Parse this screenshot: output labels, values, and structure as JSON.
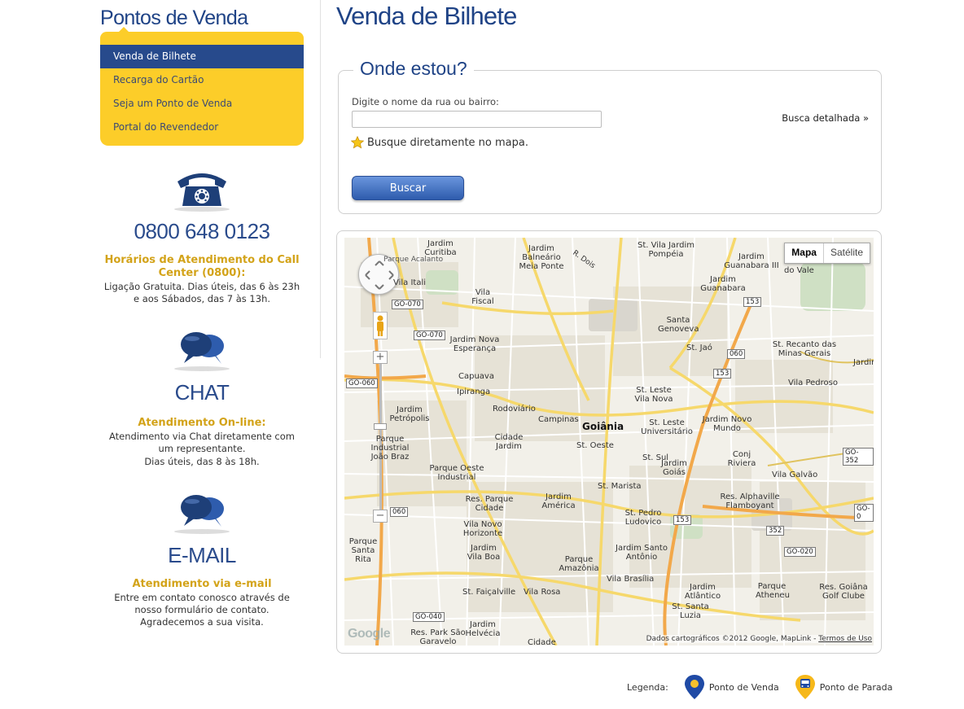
{
  "sidebar": {
    "title": "Pontos de Venda",
    "menu": [
      {
        "label": "Venda de Bilhete",
        "active": true
      },
      {
        "label": "Recarga do Cartão",
        "active": false
      },
      {
        "label": "Seja um Ponto de Venda",
        "active": false
      },
      {
        "label": "Portal do Revendedor",
        "active": false
      }
    ],
    "phone": {
      "icon": "telephone-icon",
      "number": "0800 648 0123",
      "heading": "Horários de Atendimento do Call Center (0800):",
      "text": "Ligação Gratuita. Dias úteis, das 6 às 23h e aos Sábados, das 7 às 13h."
    },
    "chat": {
      "icon": "chat-bubbles-icon",
      "title": "CHAT",
      "heading": "Atendimento On-line:",
      "text": "Atendimento via Chat diretamente com um representante.",
      "text2": "Dias úteis, das 8 às 18h."
    },
    "email": {
      "icon": "chat-bubbles-icon",
      "title": "E-MAIL",
      "heading": "Atendimento via e-mail",
      "text": "Entre em contato conosco através de nosso formulário de contato. Agradecemos a sua visita."
    }
  },
  "main": {
    "title": "Venda de Bilhete",
    "search": {
      "legend": "Onde estou?",
      "label": "Digite o nome da rua ou bairro:",
      "value": "",
      "placeholder": "",
      "detail_link": "Busca detalhada »",
      "star_text": "Busque diretamente no mapa.",
      "button": "Buscar"
    },
    "map": {
      "type_buttons": [
        "Mapa",
        "Satélite"
      ],
      "active_type": "Mapa",
      "attribution": "Dados cartográficos ©2012 Google, MapLink - ",
      "terms": "Termos de Uso",
      "logo": "Google",
      "labels": [
        "Jardim Curitiba",
        "Jardim Balneário Meia Ponte",
        "St. Vila Jardim Pompéia",
        "Jardim Guanabara III",
        "Jardim Guanabara",
        "Vila Fiscal",
        "Santa Genoveva",
        "Jardim Nova Esperança",
        "St. Jaó",
        "St. Recanto das Minas Gerais",
        "Capuava",
        "Ipiranga",
        "Vila Pedroso",
        "Rodoviário",
        "St. Leste Vila Nova",
        "Jardim Petrópolis",
        "Campinas",
        "Goiânia",
        "St. Leste Universitário",
        "Jardim Novo Mundo",
        "Cidade Jardim",
        "St. Oeste",
        "Parque Industrial João Braz",
        "St. Sul",
        "Conj Riviera",
        "Jardim Goiás",
        "Vila Galvão",
        "Parque Oeste Industrial",
        "St. Marista",
        "Res. Parque Cidade",
        "Jardim América",
        "St. Pedro Ludovico",
        "Res. Alphaville Flamboyant",
        "Vila Novo Horizonte",
        "Jardim Vila Boa",
        "Parque Santa Rita",
        "Jardim Santo Antônio",
        "Parque Amazônia",
        "Vila Brasília",
        "Jardim Atlântico",
        "St. Faiçalville",
        "Vila Rosa",
        "Parque Atheneu",
        "Res. Goiâna Golf Clube",
        "St. Santa Luzia",
        "Jardim Helvécia",
        "Res. Park São Garavelo",
        "Cidade",
        "Vila Itali",
        "do Vale",
        "Jardim Olive",
        "R. Dois",
        "Parque Acalanto"
      ],
      "road_shields": [
        "GO-070",
        "GO-070",
        "GO-060",
        "153",
        "060",
        "153",
        "GO-352",
        "153",
        "352",
        "GO-020",
        "GO-040",
        "060",
        "GO-0"
      ]
    },
    "legend": {
      "label": "Legenda:",
      "items": [
        {
          "label": "Ponto de Venda",
          "icon": "map-pin-blue-icon",
          "color": "#1f4aa5"
        },
        {
          "label": "Ponto de Parada",
          "icon": "bus-stop-pin-icon",
          "color": "#f6b81a"
        }
      ]
    }
  },
  "colors": {
    "brand_blue": "#1f4386",
    "menu_yellow": "#fccd29",
    "active_menu": "#274a8c",
    "heading_gold": "#d3a319"
  }
}
